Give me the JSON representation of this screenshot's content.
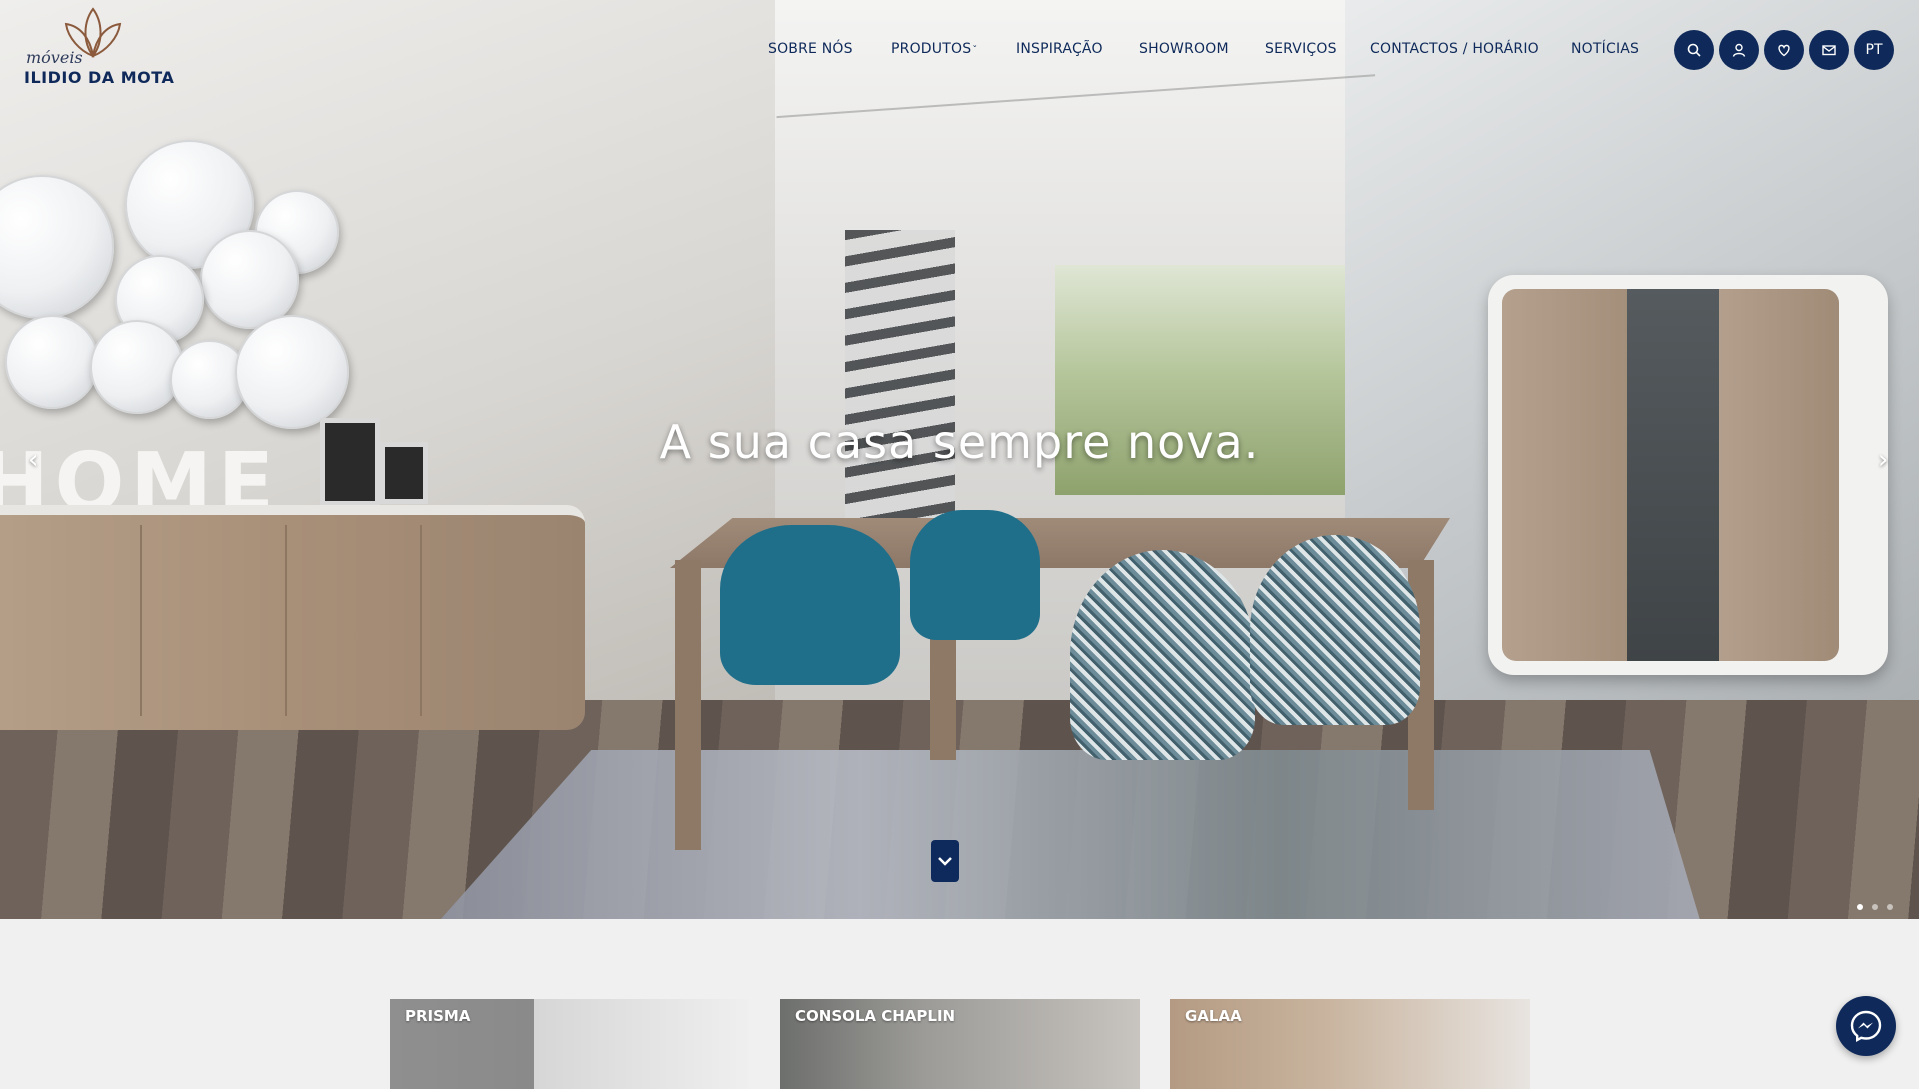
{
  "logo": {
    "small": "móveis",
    "big": "ILIDIO DA MOTA"
  },
  "nav": [
    {
      "label": "SOBRE NÓS"
    },
    {
      "label": "PRODUTOS",
      "has_dropdown": true
    },
    {
      "label": "INSPIRAÇÃO"
    },
    {
      "label": "SHOWROOM"
    },
    {
      "label": "SERVIÇOS"
    },
    {
      "label": "CONTACTOS / HORÁRIO"
    },
    {
      "label": "NOTÍCIAS"
    }
  ],
  "header_icons": {
    "search": "search-icon",
    "account": "user-icon",
    "favorites": "heart-icon",
    "contact": "mail-icon",
    "language": "PT"
  },
  "hero": {
    "tagline": "A sua casa sempre nova.",
    "decor_text": "HOME",
    "slides_total": 3,
    "active_slide": 1
  },
  "products": [
    {
      "label": "PRISMA"
    },
    {
      "label": "CONSOLA CHAPLIN"
    },
    {
      "label": "GALAA"
    }
  ],
  "colors": {
    "brand": "#0f2a5a",
    "background": "#f0f0f0"
  }
}
